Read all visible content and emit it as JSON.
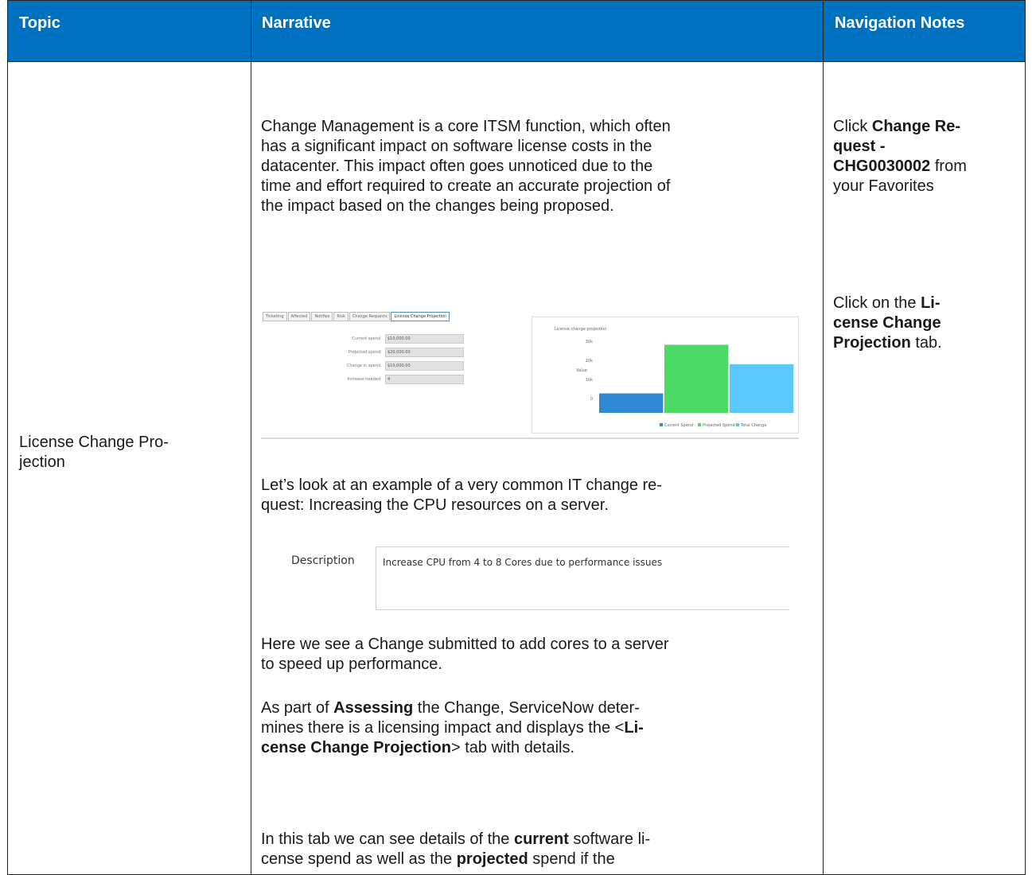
{
  "header": {
    "topic": "Topic",
    "narrative": "Narrative",
    "nav_notes": "Navigation Notes"
  },
  "row": {
    "topic_line1": "License Change Pro-",
    "topic_line2": "jection",
    "narr": {
      "p1": [
        "Change Management is a core ITSM function, which often",
        "has a significant impact on software license costs in the",
        "datacenter. This impact often goes unnoticed due to the",
        "time and effort required to create an accurate projection of",
        "the impact based on the changes being proposed."
      ],
      "p2": [
        "Let’s look at an example of a very common IT change re-",
        "quest: Increasing the CPU resources on a server."
      ],
      "p3": [
        "Here we see a Change submitted to add cores to a server",
        "to speed up performance."
      ],
      "p4": {
        "l1_a": "As part of ",
        "l1_b": "Assessing",
        "l1_c": " the Change, ServiceNow deter-",
        "l2_a": "mines there is a licensing impact and displays the <",
        "l2_b": "Li-",
        "l3_a": "cense Change Projection",
        "l3_b": "> tab with details."
      },
      "p5": {
        "l1_a": "In this tab we can see details of the ",
        "l1_b": "current",
        "l1_c": " software li-",
        "l2_a": "cense spend as well as the ",
        "l2_b": "projected",
        "l2_c": " spend if the"
      }
    },
    "nav": {
      "n1": {
        "l1_a": "Click ",
        "l1_b": "Change Re-",
        "l2_b": "quest -",
        "l3_b": "CHG0030002",
        "l3_c": " from",
        "l4": "your Favorites"
      },
      "n2": {
        "l1_a": "Click on the ",
        "l1_b": "Li-",
        "l2_b": "cense Change",
        "l3_b": "Projection",
        "l3_c": " tab."
      }
    }
  },
  "screenshot1": {
    "tabs": [
      "Ticketing",
      "Affected",
      "Notifies",
      "Risk",
      "Change Requests",
      "License Change Projection"
    ],
    "fields": [
      {
        "label": "Current spend",
        "value": "$10,000.00"
      },
      {
        "label": "Projected spend",
        "value": "$20,000.00"
      },
      {
        "label": "Change in spend",
        "value": "$10,000.00"
      },
      {
        "label": "Increase needed",
        "value": "4"
      }
    ],
    "chart_title": "License change projection",
    "chart_ylabel": "Value",
    "chart_ticks": [
      "30k",
      "20k",
      "10k",
      "0"
    ],
    "legend": [
      "Current Spend",
      "Projected Spend",
      "Total Change"
    ],
    "colors": [
      "#2f8ad6",
      "#4cd964",
      "#5ac8fa"
    ]
  },
  "chart_data": {
    "type": "bar",
    "categories": [
      "Current Spend",
      "Projected Spend",
      "Total Change"
    ],
    "values": [
      10000,
      35000,
      25000
    ],
    "title": "License change projection",
    "xlabel": "",
    "ylabel": "Value",
    "ylim": [
      0,
      45000
    ],
    "legend_position": "bottom"
  },
  "screenshot2": {
    "label": "Description",
    "text": "Increase CPU from 4 to 8 Cores due to performance issues"
  }
}
